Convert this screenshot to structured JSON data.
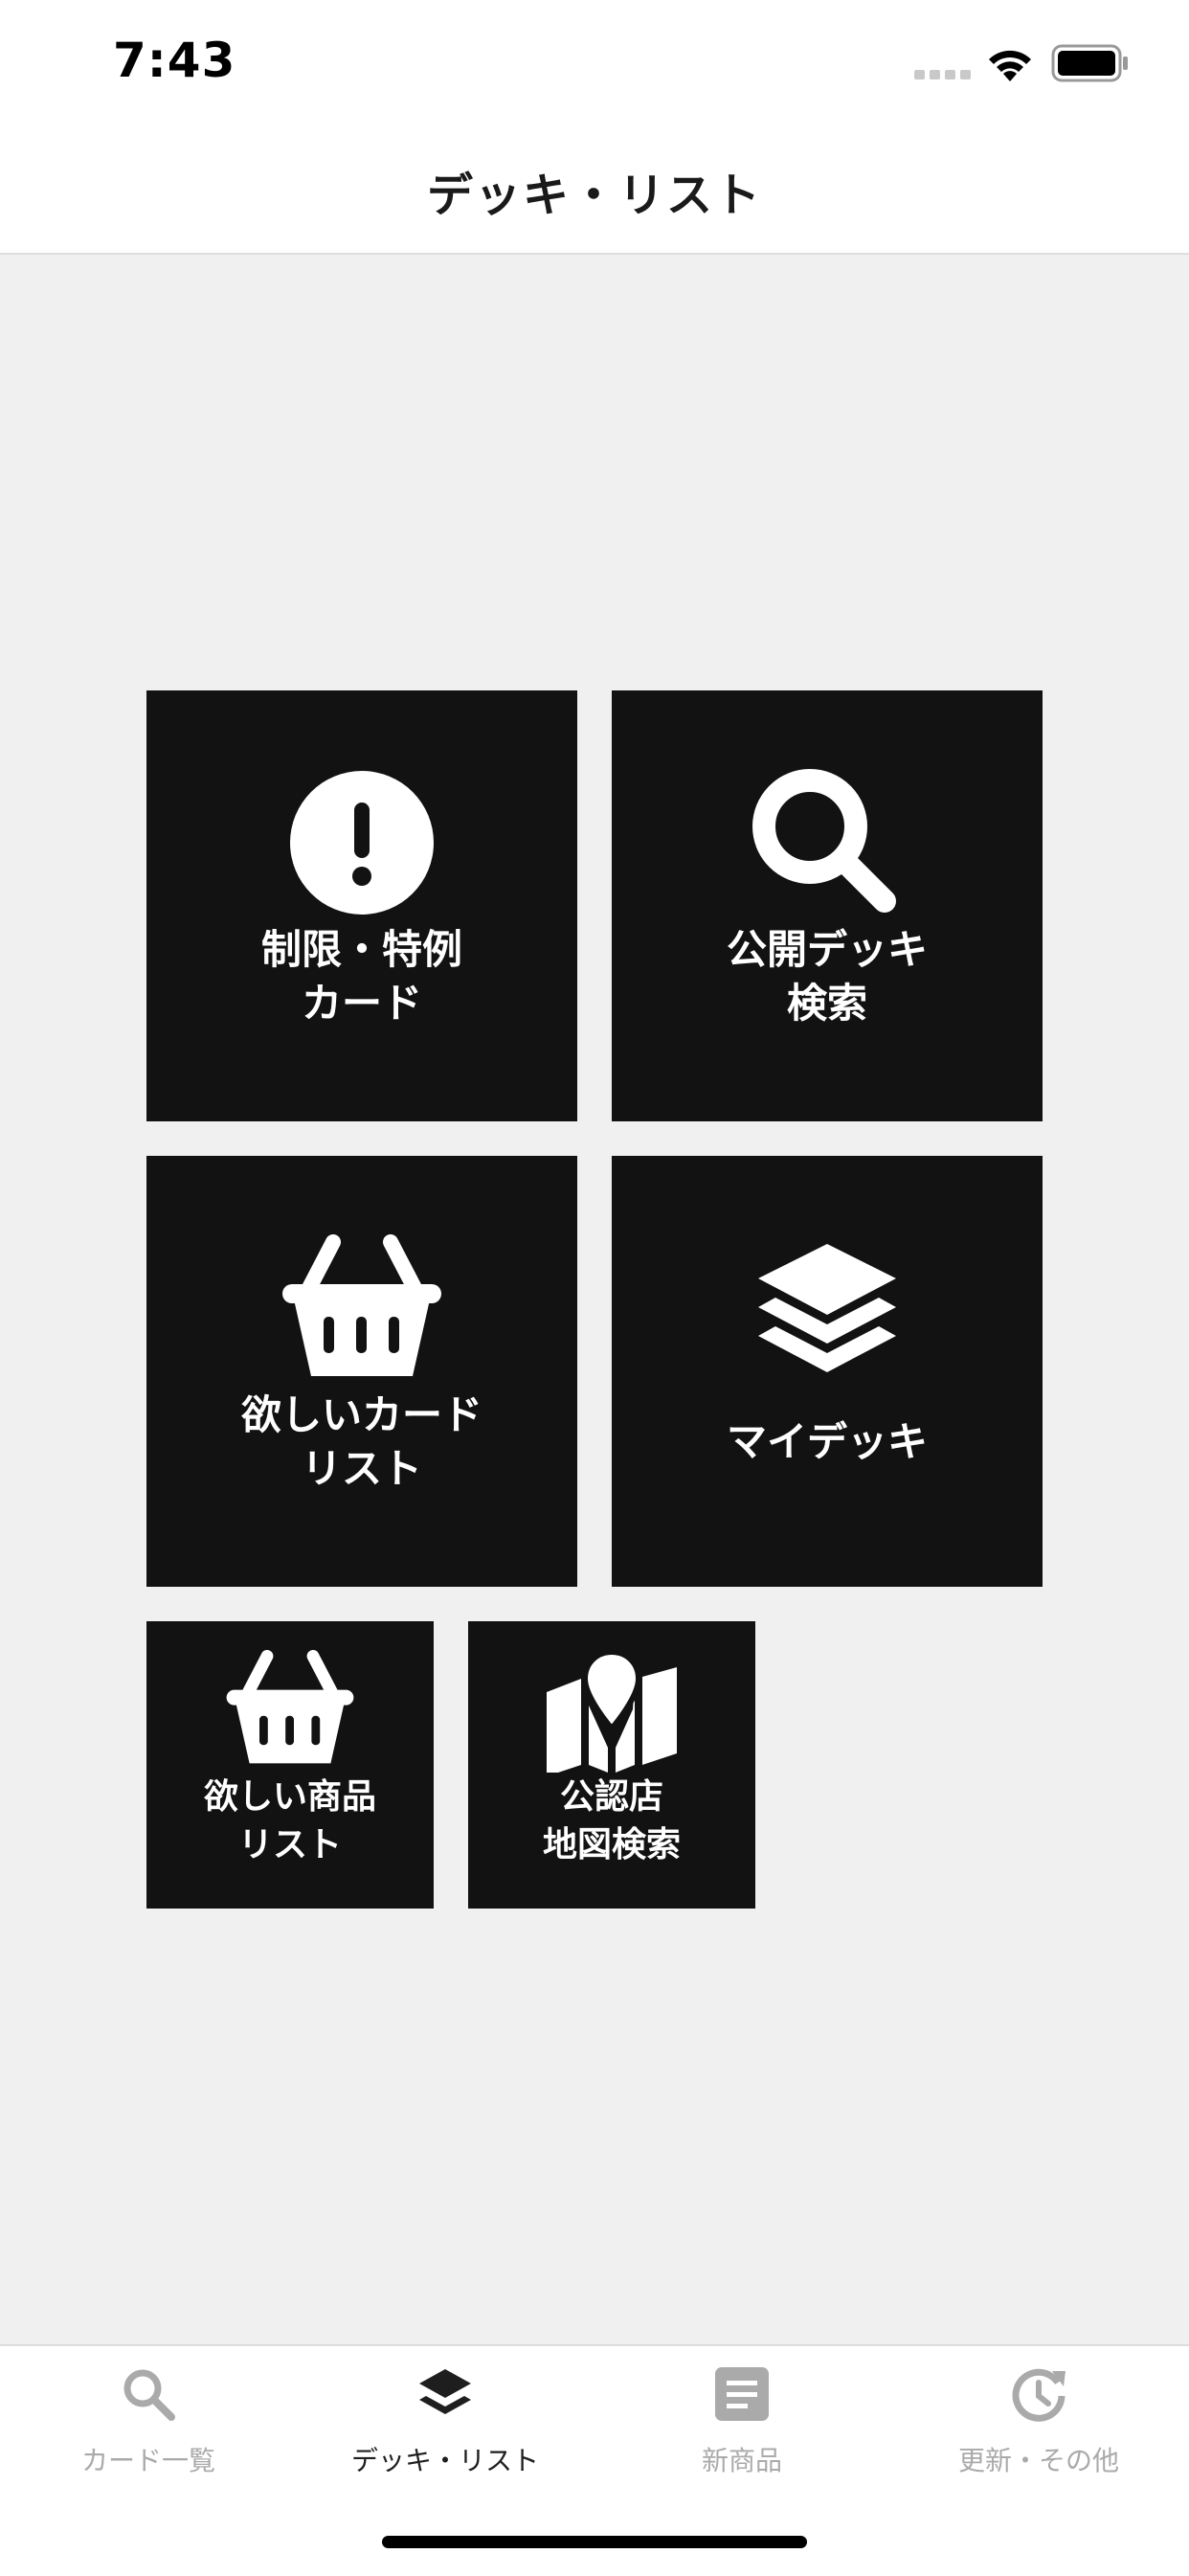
{
  "status_bar": {
    "time": "7:43"
  },
  "nav": {
    "title": "デッキ・リスト"
  },
  "tiles": [
    {
      "id": "restricted-cards",
      "icon": "exclamation-circle-icon",
      "lines": [
        "制限・特例",
        "カード"
      ]
    },
    {
      "id": "public-deck-search",
      "icon": "search-icon",
      "lines": [
        "公開デッキ",
        "検索"
      ]
    },
    {
      "id": "wanted-cards-list",
      "icon": "basket-icon",
      "lines": [
        "欲しいカード",
        "リスト"
      ]
    },
    {
      "id": "my-deck",
      "icon": "layers-icon",
      "lines": [
        "マイデッキ"
      ]
    },
    {
      "id": "wanted-products-list",
      "icon": "basket-icon",
      "lines": [
        "欲しい商品",
        "リスト"
      ]
    },
    {
      "id": "official-store-map-search",
      "icon": "map-pin-icon",
      "lines": [
        "公認店",
        "地図検索"
      ]
    }
  ],
  "tabs": [
    {
      "label": "カード一覧",
      "icon": "search-icon",
      "active": false
    },
    {
      "label": "デッキ・リスト",
      "icon": "layers-icon",
      "active": true
    },
    {
      "label": "新商品",
      "icon": "document-icon",
      "active": false
    },
    {
      "label": "更新・その他",
      "icon": "history-icon",
      "active": false
    }
  ],
  "colors": {
    "tile": "#121212",
    "background": "#f0f0f0",
    "tab_active": "#1e1e1e",
    "tab_inactive": "#aaaaaa"
  }
}
